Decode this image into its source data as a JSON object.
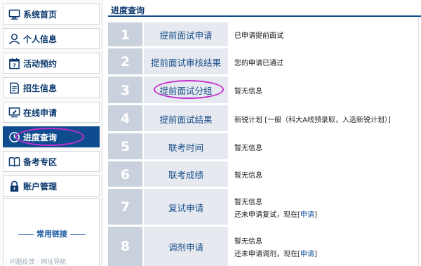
{
  "sidebar": {
    "items": [
      {
        "label": "系统首页",
        "icon": "monitor-icon"
      },
      {
        "label": "个人信息",
        "icon": "person-icon"
      },
      {
        "label": "活动预约",
        "icon": "calendar-icon"
      },
      {
        "label": "招生信息",
        "icon": "document-icon"
      },
      {
        "label": "在线申请",
        "icon": "screen-pen-icon"
      },
      {
        "label": "进度查询",
        "icon": "clock-icon",
        "active": true
      },
      {
        "label": "备考专区",
        "icon": "book-icon"
      },
      {
        "label": "账户管理",
        "icon": "lock-icon"
      }
    ],
    "links_title": "常用链接",
    "faint_text": "·  问题反馈 · 网址导航"
  },
  "main": {
    "title": "进度查询",
    "steps": [
      {
        "num": "1",
        "name": "提前面试申请",
        "status": "已申请提前面试"
      },
      {
        "num": "2",
        "name": "提前面试审核结果",
        "status": "您的申请已通过"
      },
      {
        "num": "3",
        "name": "提前面试分组",
        "status": "暂无信息"
      },
      {
        "num": "4",
        "name": "提前面试结果",
        "status": "新锐计划 [一般（科大A线预录取，入选新锐计划）]"
      },
      {
        "num": "5",
        "name": "联考时间",
        "status": "暂无信息"
      },
      {
        "num": "6",
        "name": "联考成绩",
        "status": "暂无信息"
      },
      {
        "num": "7",
        "name": "复试申请",
        "status": "暂无信息",
        "status2_prefix": "还未申请复试，现在[",
        "status2_link": "申请",
        "status2_suffix": "]"
      },
      {
        "num": "8",
        "name": "调剂申请",
        "status": "暂无信息",
        "status2_prefix": "还未申请调剂，现在[",
        "status2_link": "申请",
        "status2_suffix": "]"
      }
    ]
  },
  "colors": {
    "accent": "#0f4c8f",
    "highlight_oval": "#c32fcf",
    "number_cell": "#c8d1dc",
    "step_cell": "#e6eaf0"
  }
}
